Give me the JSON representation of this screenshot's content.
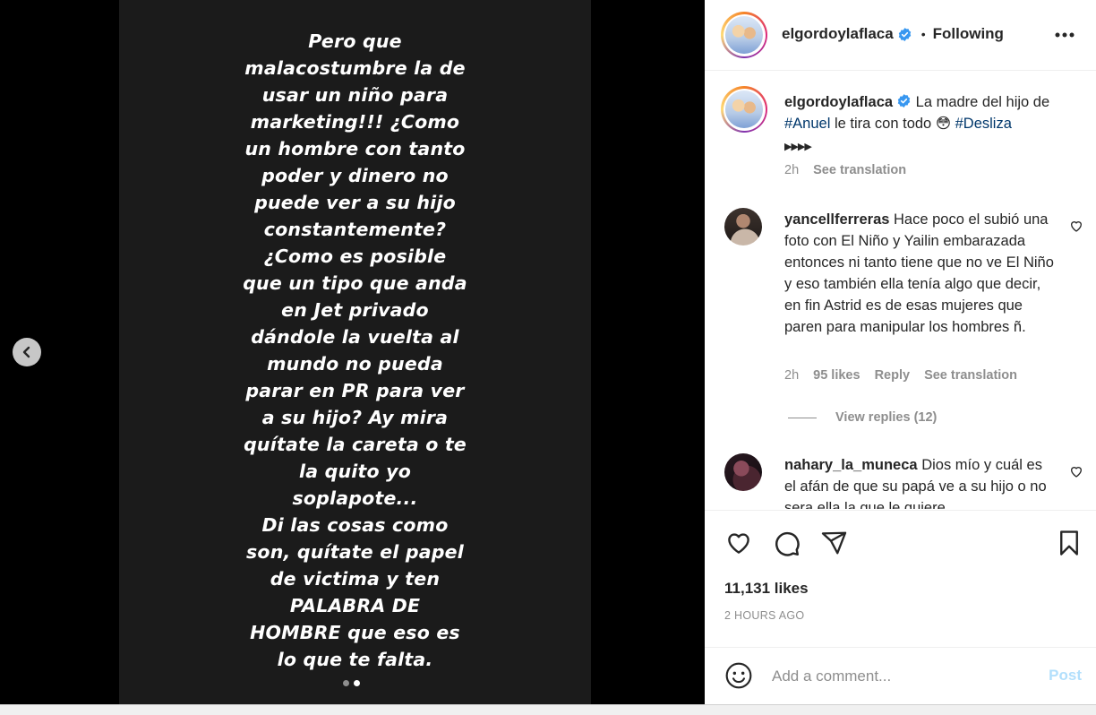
{
  "story": {
    "text": "Pero que\nmalacostumbre la de\nusar un niño para\nmarketing!!! ¿Como\nun hombre con tanto\npoder y dinero no\npuede ver a su hijo\nconstantemente?\n¿Como es posible\nque un tipo que anda\nen Jet privado\ndándole la vuelta al\nmundo no pueda\nparar en PR para ver\na su hijo? Ay mira\nquítate la careta o te\nla quito yo\nsoplapote...\nDi las cosas como\nson, quítate el papel\nde victima y ten\nPALABRA DE\nHOMBRE que eso es\nlo que te falta.",
    "slide_count": 2,
    "active_slide": 2
  },
  "header": {
    "username": "elgordoylaflaca",
    "separator": "•",
    "follow_status": "Following",
    "more_icon": "more-horizontal-icon"
  },
  "caption": {
    "username": "elgordoylaflaca",
    "text_1": "La madre del hijo de",
    "tag_1": "#Anuel",
    "text_2": "le tira con todo",
    "emoji": "😳",
    "tag_2": "#Desliza",
    "arrows": "▶▶▶▶",
    "time": "2h",
    "see_translation": "See translation"
  },
  "comments": [
    {
      "username": "yancellferreras",
      "text": "Hace poco el subió una foto con El Niño y Yailin embarazada entonces ni tanto tiene que no ve El Niño y eso también ella tenía algo que decir, en fin Astrid es de esas mujeres que paren para manipular los hombres ñ.",
      "time": "2h",
      "likes": "95 likes",
      "reply": "Reply",
      "see_translation": "See translation",
      "view_replies": "View replies (12)"
    },
    {
      "username": "nahary_la_muneca",
      "text": "Dios mío y cuál es el afán de que su papá ve a su hijo o no sera ella la que le quiere"
    }
  ],
  "actions": {
    "likes": "11,131 likes",
    "time_ago": "2 HOURS AGO"
  },
  "add_comment": {
    "placeholder": "Add a comment...",
    "post_label": "Post"
  },
  "colors": {
    "verified": "#3897f0",
    "hashtag": "#00376b",
    "post_disabled": "#b2dffc",
    "muted": "#8e8e8e"
  }
}
